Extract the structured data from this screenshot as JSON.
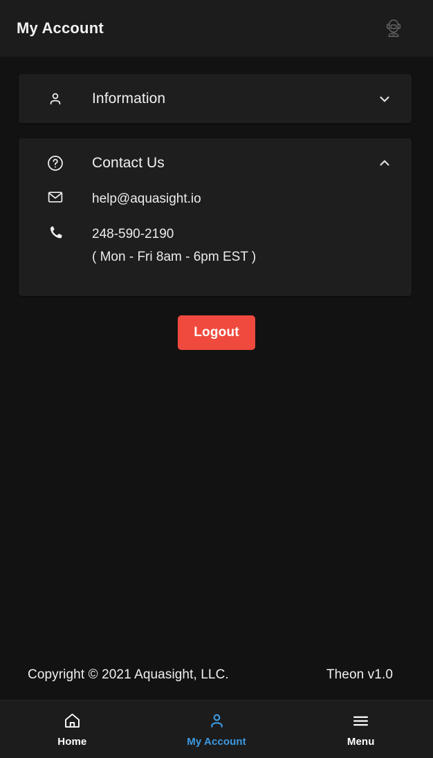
{
  "header": {
    "title": "My Account",
    "support_icon": "support-bot-icon"
  },
  "sections": [
    {
      "id": "information",
      "label": "Information",
      "icon": "person-icon",
      "chevron": "chevron-down-icon",
      "expanded": false
    },
    {
      "id": "contact-us",
      "label": "Contact Us",
      "icon": "help-circle-icon",
      "chevron": "chevron-up-icon",
      "expanded": true
    }
  ],
  "contact": {
    "email": "help@aquasight.io",
    "email_icon": "mail-icon",
    "phone": "248-590-2190",
    "phone_icon": "phone-icon",
    "hours": "( Mon - Fri 8am - 6pm EST )"
  },
  "actions": {
    "logout_label": "Logout",
    "logout_color": "#f04a3e"
  },
  "footer": {
    "copyright": "Copyright © 2021 Aquasight, LLC.",
    "version": "Theon v1.0"
  },
  "bottom_nav": {
    "active_color": "#3d9ae2",
    "items": [
      {
        "id": "home",
        "label": "Home",
        "icon": "home-icon",
        "active": false
      },
      {
        "id": "my-account",
        "label": "My Account",
        "icon": "person-icon",
        "active": true
      },
      {
        "id": "menu",
        "label": "Menu",
        "icon": "hamburger-menu-icon",
        "active": false
      }
    ]
  }
}
